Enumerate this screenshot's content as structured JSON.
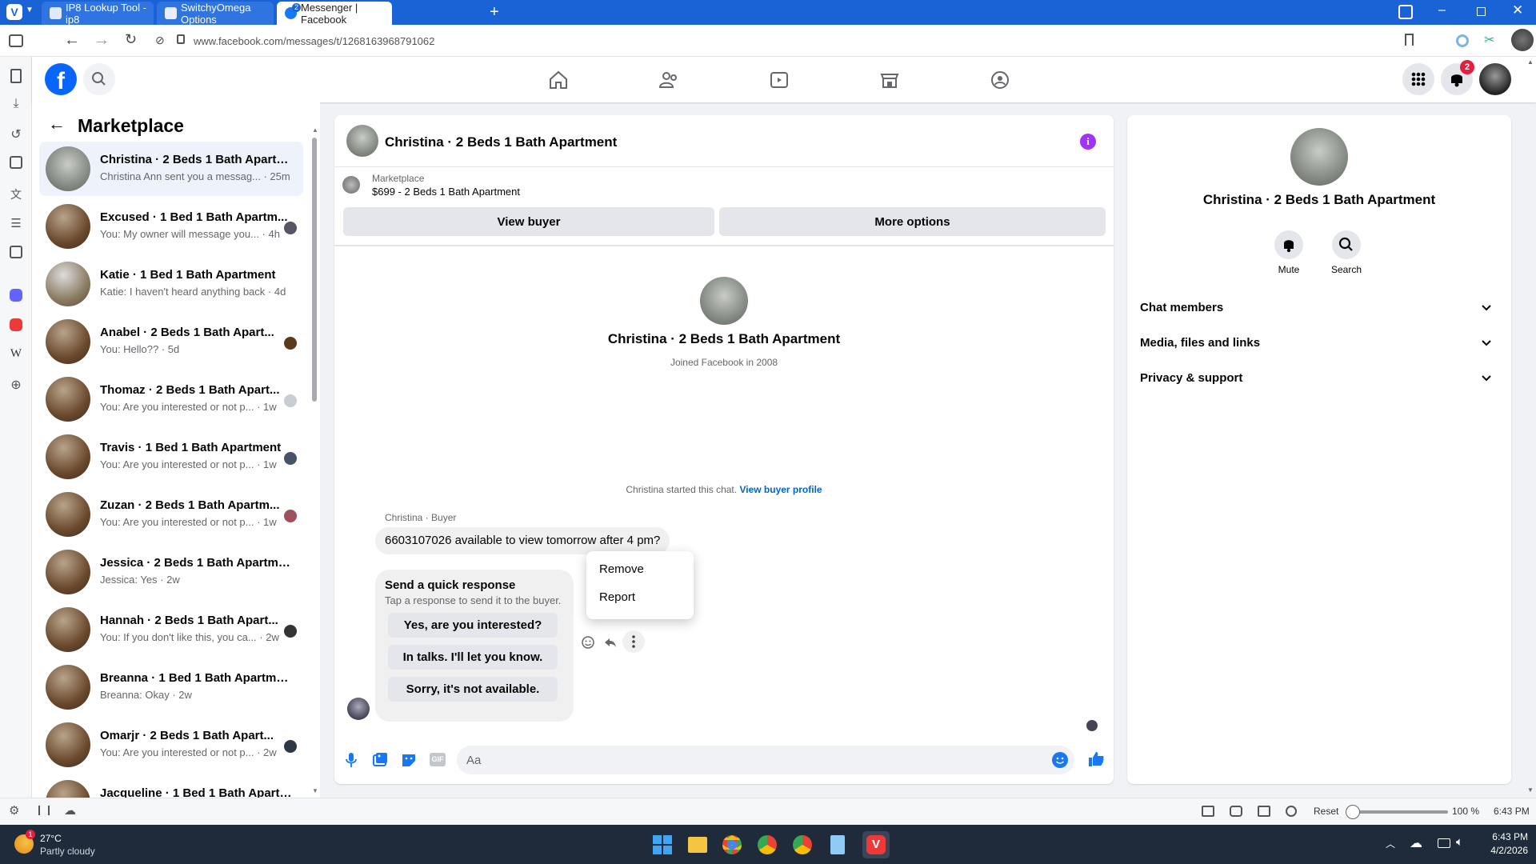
{
  "browser": {
    "tabs": [
      {
        "title": "IP8 Lookup Tool - ip8",
        "active": false
      },
      {
        "title": "SwitchyOmega Options",
        "active": false
      },
      {
        "title": "Messenger | Facebook",
        "active": true,
        "badge": "2"
      }
    ],
    "url": "www.facebook.com/messages/t/1268163968791062"
  },
  "fb": {
    "notifications_count": "2"
  },
  "inbox": {
    "title": "Marketplace",
    "conversations": [
      {
        "name": "Christina · 2 Beds 1 Bath Apartm...",
        "preview": "Christina Ann sent you a messag... · 25m",
        "selected": true
      },
      {
        "name": "Excused · 1 Bed 1 Bath Apartm...",
        "preview": "You: My owner will message you... · 4h"
      },
      {
        "name": "Katie · 1 Bed 1 Bath Apartment",
        "preview": "Katie: I haven't heard anything back · 4d"
      },
      {
        "name": "Anabel · 2 Beds 1 Bath Apart...",
        "preview": "You: Hello?? · 5d"
      },
      {
        "name": "Thomaz · 2 Beds 1 Bath Apart...",
        "preview": "You: Are you interested or not p... · 1w"
      },
      {
        "name": "Travis · 1 Bed 1 Bath Apartment",
        "preview": "You: Are you interested or not p... · 1w"
      },
      {
        "name": "Zuzan · 2 Beds 1 Bath Apartm...",
        "preview": "You: Are you interested or not p... · 1w"
      },
      {
        "name": "Jessica · 2 Beds 1 Bath Apartment",
        "preview": "Jessica: Yes · 2w"
      },
      {
        "name": "Hannah · 2 Beds 1 Bath Apart...",
        "preview": "You: If you don't like this, you ca... · 2w"
      },
      {
        "name": "Breanna · 1 Bed 1 Bath Apartment",
        "preview": "Breanna: Okay · 2w"
      },
      {
        "name": "Omarjr · 2 Beds 1 Bath Apart...",
        "preview": "You: Are you interested or not p... · 2w"
      },
      {
        "name": "Jacqueline · 1 Bed 1 Bath Apartm...",
        "preview": ""
      }
    ]
  },
  "chat": {
    "header_title": "Christina · 2 Beds 1 Bath Apartment",
    "listing_label": "Marketplace",
    "listing_text": "$699 - 2 Beds 1 Bath Apartment",
    "view_buyer": "View buyer",
    "more_options": "More options",
    "profile_name": "Christina · 2 Beds 1 Bath Apartment",
    "joined": "Joined Facebook in 2008",
    "started_text": "Christina started this chat.",
    "view_buyer_profile": "View buyer profile",
    "sender_label": "Christina · Buyer",
    "message": "6603107026 available to view tomorrow after 4 pm?",
    "quick_title": "Send a quick response",
    "quick_sub": "Tap a response to send it to the buyer.",
    "quick_responses": [
      "Yes, are you interested?",
      "In talks. I'll let you know.",
      "Sorry, it's not available."
    ],
    "menu": [
      "Remove",
      "Report"
    ],
    "composer_placeholder": "Aa"
  },
  "info": {
    "name": "Christina · 2 Beds 1 Bath Apartment",
    "mute": "Mute",
    "search": "Search",
    "sections": [
      "Chat members",
      "Media, files and links",
      "Privacy & support"
    ]
  },
  "statusbar": {
    "reset": "Reset",
    "zoom": "100 %",
    "time": "6:43 PM"
  },
  "taskbar": {
    "temp": "27°C",
    "weather": "Partly cloudy",
    "weather_badge": "1",
    "time": "6:43 PM",
    "date": "4/2/2026"
  },
  "colors": {
    "fb_blue": "#0866ff",
    "accent_blue": "#1877f2",
    "tab_blue": "#1a63d6",
    "purple": "#a033ff"
  }
}
